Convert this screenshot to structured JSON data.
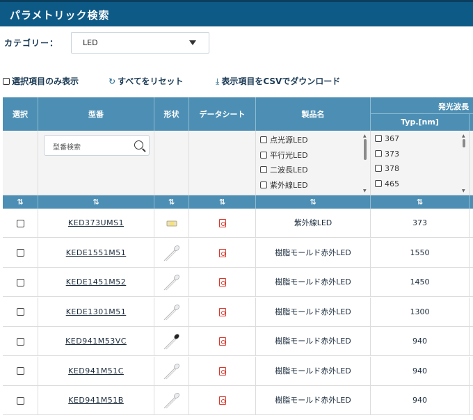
{
  "header": {
    "title": "パラメトリック検索"
  },
  "category": {
    "label": "カテゴリー：",
    "selected": "LED"
  },
  "toolbar": {
    "show_selected": "選択項目のみ表示",
    "reset_all": "すべてをリセット",
    "download_csv": "表示項目をCSVでダウンロード"
  },
  "table": {
    "headers": {
      "select": "選択",
      "model": "型番",
      "shape": "形状",
      "datasheet": "データシート",
      "product_name": "製品名",
      "wavelength": "発光波長",
      "wavelength_typ": "Typ.[nm]"
    },
    "sort_glyph": "⇅",
    "filters": {
      "model_placeholder": "型番検索",
      "product_options": [
        "点光源LED",
        "平行光LED",
        "二波長LED",
        "紫外線LED"
      ],
      "wavelength_options": [
        "367",
        "373",
        "378",
        "465"
      ]
    },
    "rows": [
      {
        "model": "KED373UMS1",
        "product": "紫外線LED",
        "wavelength": "373",
        "shape": "smd-led-icon"
      },
      {
        "model": "KEDE1551M51",
        "product": "樹脂モールド赤外LED",
        "wavelength": "1550",
        "shape": "lead-led-icon"
      },
      {
        "model": "KEDE1451M52",
        "product": "樹脂モールド赤外LED",
        "wavelength": "1450",
        "shape": "lead-led-icon"
      },
      {
        "model": "KEDE1301M51",
        "product": "樹脂モールド赤外LED",
        "wavelength": "1300",
        "shape": "lead-led-icon"
      },
      {
        "model": "KED941M53VC",
        "product": "樹脂モールド赤外LED",
        "wavelength": "940",
        "shape": "dark-led-icon"
      },
      {
        "model": "KED941M51C",
        "product": "樹脂モールド赤外LED",
        "wavelength": "940",
        "shape": "lead-led-icon"
      },
      {
        "model": "KED941M51B",
        "product": "樹脂モールド赤外LED",
        "wavelength": "940",
        "shape": "lead-led-icon"
      }
    ]
  },
  "colors": {
    "header_bg": "#0e5a86",
    "table_header_bg": "#4d8fb4",
    "pdf_red": "#d9362b"
  }
}
